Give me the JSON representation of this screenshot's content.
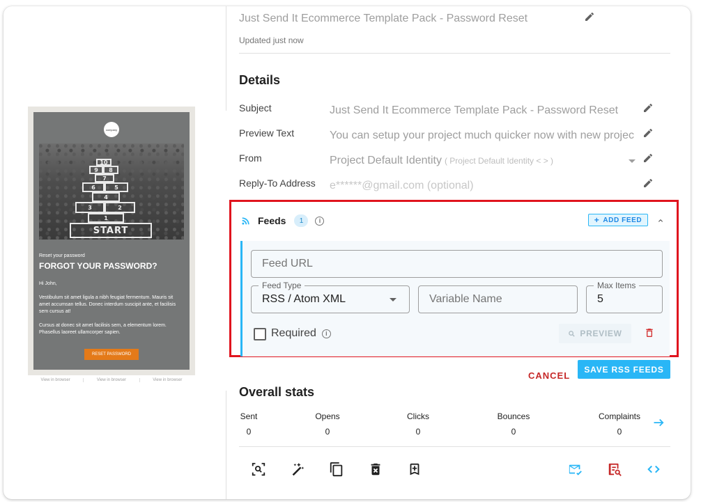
{
  "template": {
    "name": "Just Send It Ecommerce Template Pack - Password Reset",
    "updated": "Updated just now"
  },
  "email_preview": {
    "logo_text": "company",
    "hop_labels": [
      "10",
      "9",
      "8",
      "7",
      "6",
      "5",
      "4",
      "3",
      "2",
      "1",
      "START"
    ],
    "subtitle": "Reset your password",
    "title": "FORGOT YOUR PASSWORD?",
    "greeting": "Hi John,",
    "para1": "Vestibulum sit amet ligula a nibh feugiat fermentum. Mauris sit amet accumsan tellus. Donec interdum suscipit ante, et facilisis sem cursus at!",
    "para2": "Cursus at donec sit amet facilisis sem, a elementum lorem. Phasellus laoreet ullamcorper sapien.",
    "button": "RESET PASSWORD",
    "footer_links": [
      "View in browser",
      "View in browser",
      "View in browser"
    ]
  },
  "details": {
    "title": "Details",
    "rows": [
      {
        "label": "Subject",
        "value": "Just Send It Ecommerce Template Pack - Password Reset"
      },
      {
        "label": "Preview Text",
        "value": "You can setup your project much quicker now with new projec"
      },
      {
        "label": "From",
        "value": "Project Default Identity",
        "sub": "( Project Default Identity < > )"
      },
      {
        "label": "Reply-To Address",
        "value": "e******@gmail.com (optional)"
      }
    ]
  },
  "feeds": {
    "title": "Feeds",
    "count": "1",
    "add_label": "ADD FEED",
    "feed_url_placeholder": "Feed URL",
    "feed_type_label": "Feed Type",
    "feed_type_value": "RSS / Atom XML",
    "variable_placeholder": "Variable Name",
    "max_items_label": "Max Items",
    "max_items_value": "5",
    "required_label": "Required",
    "preview_label": "PREVIEW",
    "cancel_label": "CANCEL",
    "save_label": "SAVE RSS FEEDS"
  },
  "stats": {
    "title": "Overall stats",
    "items": [
      {
        "label": "Sent",
        "value": "0"
      },
      {
        "label": "Opens",
        "value": "0"
      },
      {
        "label": "Clicks",
        "value": "0"
      },
      {
        "label": "Bounces",
        "value": "0"
      },
      {
        "label": "Complaints",
        "value": "0"
      }
    ]
  },
  "toolbar": {
    "icons": [
      "zoom-preview-icon",
      "magic-wand-icon",
      "copy-icon",
      "delete-icon",
      "bookmark-add-icon",
      "send-check-icon",
      "search-document-icon",
      "code-icon"
    ]
  },
  "colors": {
    "accent": "#29b6f6",
    "danger": "#c62828",
    "highlight_border": "#e0141e",
    "email_button": "#e47a19"
  }
}
